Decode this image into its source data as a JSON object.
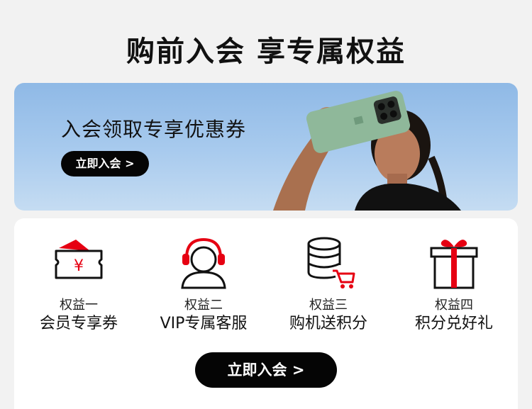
{
  "page_title": "购前入会 享专属权益",
  "banner": {
    "headline": "入会领取专享优惠券",
    "button_label": "立即入会 >"
  },
  "benefits": [
    {
      "label": "权益一",
      "desc": "会员专享券",
      "icon": "coupon-icon"
    },
    {
      "label": "权益二",
      "desc": "VIP专属客服",
      "icon": "customer-service-icon"
    },
    {
      "label": "权益三",
      "desc": "购机送积分",
      "icon": "points-cart-icon"
    },
    {
      "label": "权益四",
      "desc": "积分兑好礼",
      "icon": "gift-icon"
    }
  ],
  "join_button_label": "立即入会 >",
  "colors": {
    "accent": "#e60012",
    "button": "#050505",
    "card": "#ffffff",
    "background": "#f2f2f2"
  }
}
